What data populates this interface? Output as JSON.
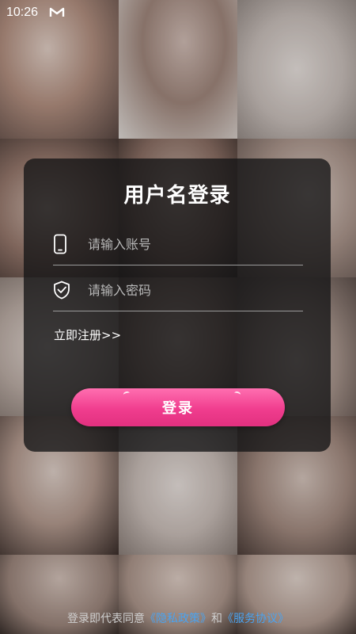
{
  "status_bar": {
    "time": "10:26",
    "app_icon": "m-logo-icon"
  },
  "login": {
    "title": "用户名登录",
    "account_placeholder": "请输入账号",
    "password_placeholder": "请输入密码",
    "account_icon": "phone-icon",
    "password_icon": "shield-check-icon",
    "register_label": "立即注册>>",
    "submit_label": "登录"
  },
  "agreement": {
    "prefix": "登录即代表同意",
    "privacy_link": "《隐私政策》",
    "conjunction": "和",
    "service_link": "《服务协议》"
  },
  "colors": {
    "button_gradient_top": "#ff6fb0",
    "button_gradient_bottom": "#e2307f",
    "link": "#4aa3f0",
    "card_background": "rgba(20,20,22,0.78)"
  }
}
